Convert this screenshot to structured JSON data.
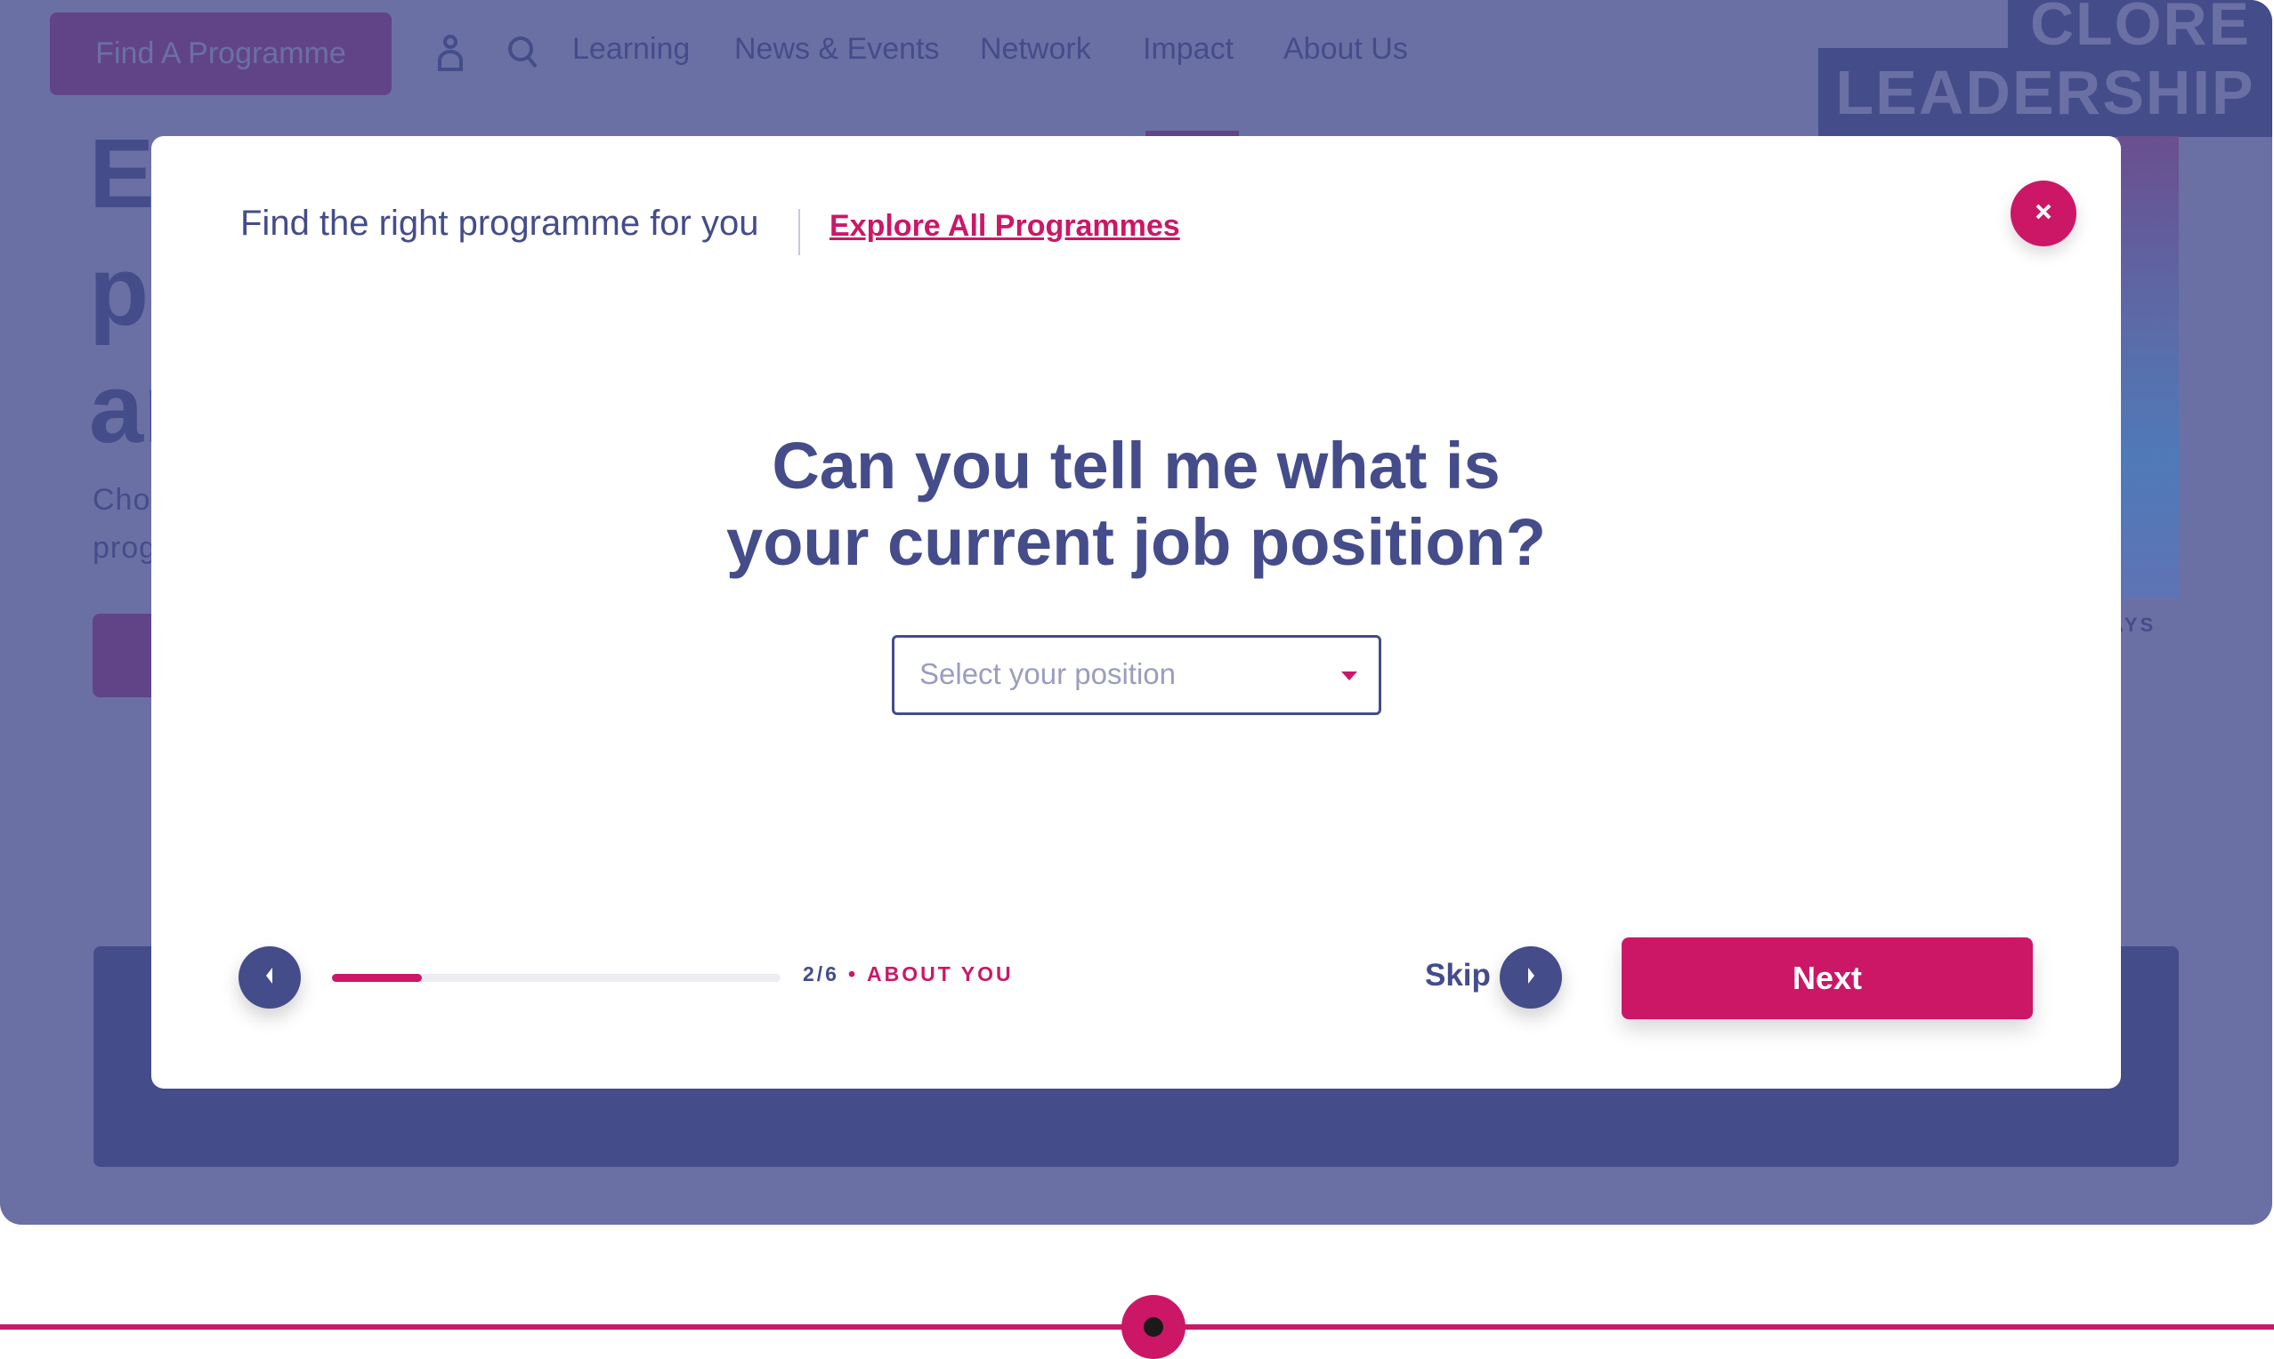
{
  "nav": {
    "find_programme": "Find A Programme",
    "links": [
      "Learning",
      "News & Events",
      "Network",
      "Impact",
      "About Us"
    ],
    "active": "Impact",
    "icons": [
      "user-icon",
      "search-icon"
    ]
  },
  "logo": {
    "line1": "CLORE",
    "line2": "LEADERSHIP"
  },
  "hero": {
    "title_fragments": [
      "Ex",
      "p",
      "ar"
    ],
    "subtitle_fragments": [
      "Choo",
      "prog"
    ],
    "caption_fragment": "AYS"
  },
  "modal": {
    "header_text": "Find the right programme for you",
    "explore_link": "Explore All Programmes",
    "close_icon": "close-icon",
    "question_line1": "Can you tell me what is",
    "question_line2": "your current job position?",
    "select": {
      "placeholder": "Select your position",
      "value": ""
    },
    "progress": {
      "current": 2,
      "total": 6,
      "fill_fraction": 0.2
    },
    "step_count": "2/6",
    "step_separator": "•",
    "step_name": "ABOUT YOU",
    "skip_label": "Skip",
    "next_label": "Next"
  },
  "colors": {
    "primary": "#444c8a",
    "accent": "#cc1767",
    "overlay": "#6b70a4",
    "track": "#ececf2"
  }
}
